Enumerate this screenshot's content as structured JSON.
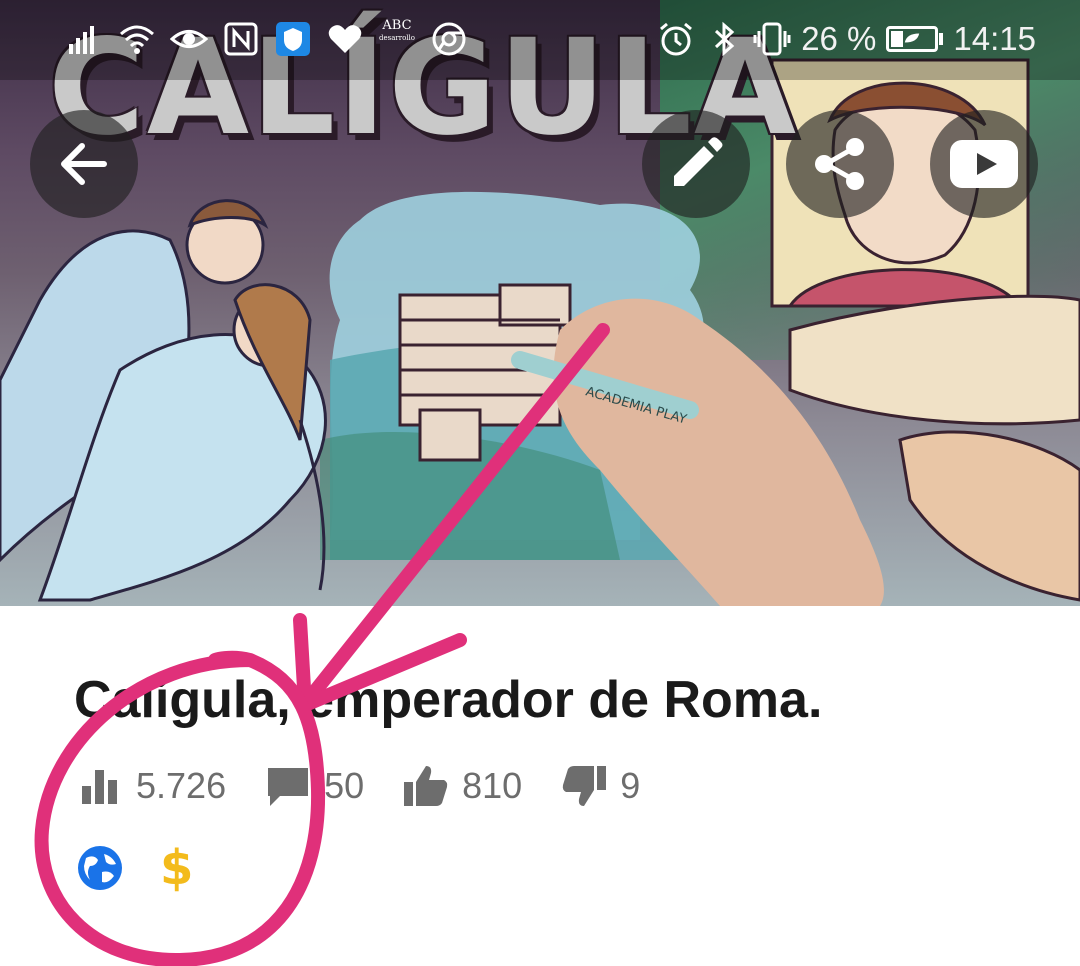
{
  "status_bar": {
    "left_icons": [
      "signal-icon",
      "wifi-icon",
      "eye-icon",
      "nfc-icon",
      "shield-app-icon",
      "heart-icon",
      "abc-app-icon",
      "chrome-icon"
    ],
    "abc_label": "ABC",
    "abc_sublabel": "desarrollo",
    "right_icons": [
      "alarm-icon",
      "bluetooth-icon",
      "vibrate-icon"
    ],
    "battery_percent": "26 %",
    "battery_level": 0.26,
    "time": "14:15"
  },
  "thumbnail": {
    "title_text": "CALÍGULA",
    "pen_brand": "ACADEMIA PLAY"
  },
  "overlay_buttons": {
    "back": "arrow-back-icon",
    "edit": "pencil-icon",
    "share": "share-icon",
    "youtube": "youtube-icon"
  },
  "video": {
    "title": "Calígula, emperador de Roma.",
    "stats": {
      "views": "5.726",
      "comments": "50",
      "likes": "810",
      "dislikes": "9"
    },
    "badges": {
      "globe": "globe-icon",
      "monetized": "$"
    }
  },
  "colors": {
    "annotation": "#e0307a",
    "monetized": "#f3bb1c",
    "globe": "#1a73e8",
    "stat_gray": "#6d6d6d"
  }
}
